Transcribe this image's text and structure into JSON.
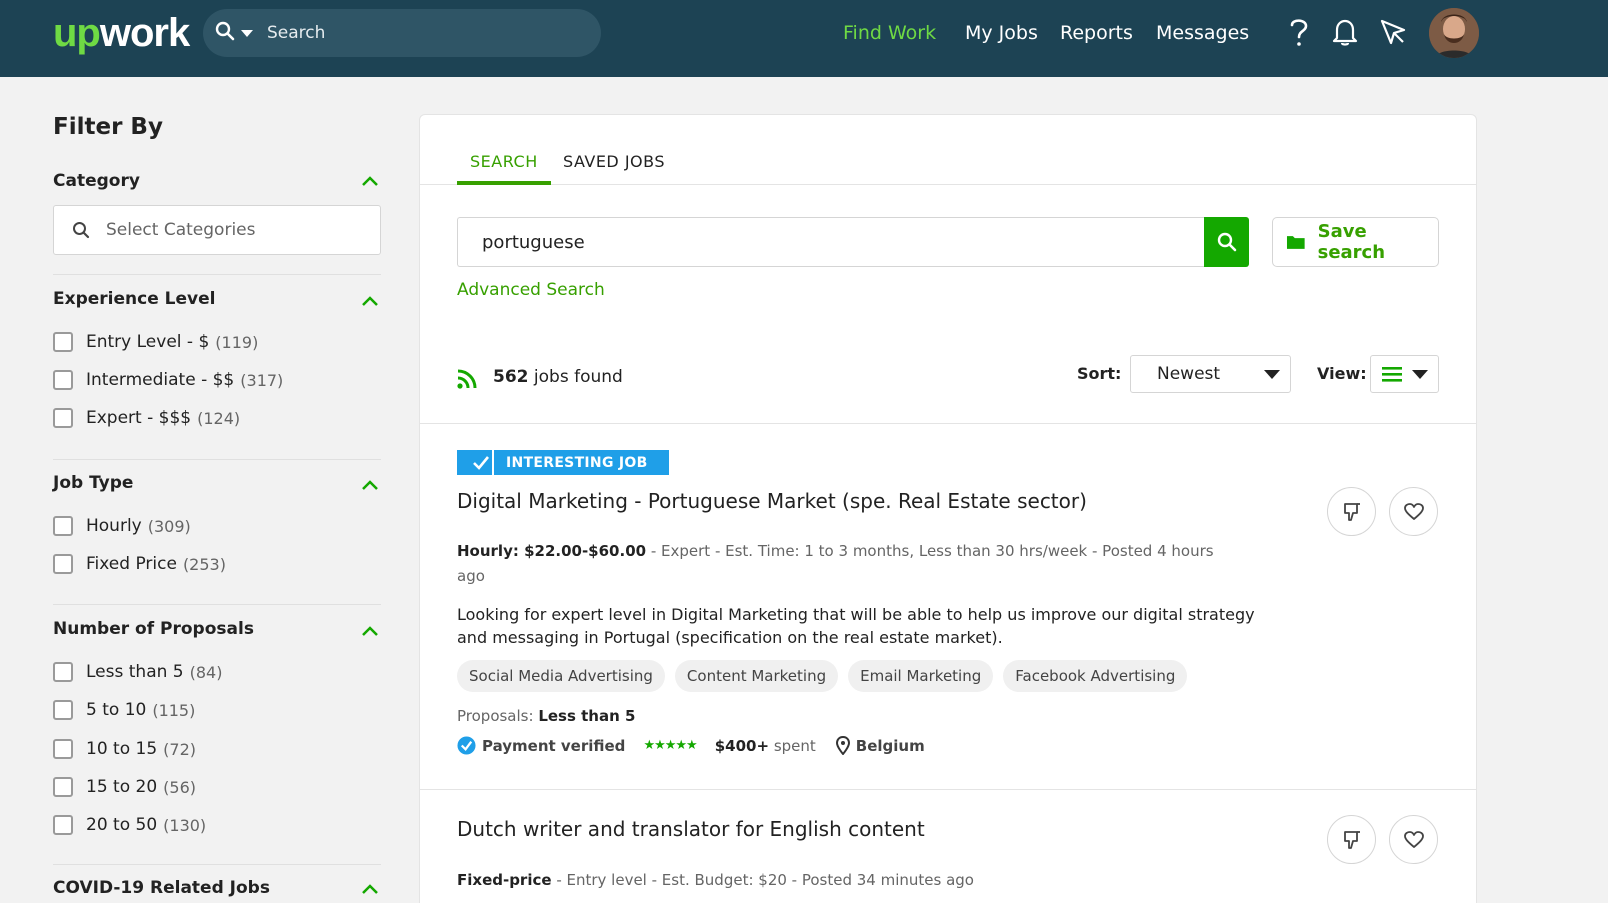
{
  "header": {
    "logo_up": "up",
    "logo_work": "work",
    "search_placeholder": "Search",
    "nav": [
      "Find Work",
      "My Jobs",
      "Reports",
      "Messages"
    ],
    "colors": {
      "bar": "#1d4354",
      "accent": "#6fda44"
    }
  },
  "sidebar": {
    "title": "Filter By",
    "category": {
      "title": "Category",
      "placeholder": "Select Categories"
    },
    "experience": {
      "title": "Experience Level",
      "items": [
        {
          "label": "Entry Level - $",
          "count": "(119)"
        },
        {
          "label": "Intermediate - $$",
          "count": "(317)"
        },
        {
          "label": "Expert - $$$",
          "count": "(124)"
        }
      ]
    },
    "job_type": {
      "title": "Job Type",
      "items": [
        {
          "label": "Hourly",
          "count": "(309)"
        },
        {
          "label": "Fixed Price",
          "count": "(253)"
        }
      ]
    },
    "proposals": {
      "title": "Number of Proposals",
      "items": [
        {
          "label": "Less than 5",
          "count": "(84)"
        },
        {
          "label": "5 to 10",
          "count": "(115)"
        },
        {
          "label": "10 to 15",
          "count": "(72)"
        },
        {
          "label": "15 to 20",
          "count": "(56)"
        },
        {
          "label": "20 to 50",
          "count": "(130)"
        }
      ]
    },
    "covid": {
      "title": "COVID-19 Related Jobs"
    }
  },
  "main": {
    "tabs": [
      "SEARCH",
      "SAVED JOBS"
    ],
    "search_value": "portuguese",
    "save_search_label": "Save search",
    "advanced_label": "Advanced Search",
    "jobs_count": "562",
    "jobs_found_text": "jobs found",
    "sort_label": "Sort:",
    "sort_value": "Newest",
    "view_label": "View:"
  },
  "jobs": [
    {
      "badge": "INTERESTING JOB",
      "title": "Digital Marketing - Portuguese Market (spe. Real Estate sector)",
      "budget": "Hourly: $22.00-$60.00",
      "meta": " - Expert - Est. Time: 1 to 3 months, Less than 30 hrs/week - Posted 4 hours ago",
      "description": "Looking for expert level in Digital Marketing that will be able to help us improve our digital strategy and messaging in Portugal (specification on the real estate market).",
      "skills": [
        "Social Media Advertising",
        "Content Marketing",
        "Email Marketing",
        "Facebook Advertising"
      ],
      "proposals_label": "Proposals:",
      "proposals_value": "Less than 5",
      "payment": "Payment verified",
      "rating": 5,
      "spent_amount": "$400+",
      "spent_label": "spent",
      "location": "Belgium"
    },
    {
      "title": "Dutch writer and translator for English content",
      "budget": "Fixed-price",
      "meta": " - Entry level - Est. Budget: $20 - Posted 34 minutes ago"
    }
  ]
}
